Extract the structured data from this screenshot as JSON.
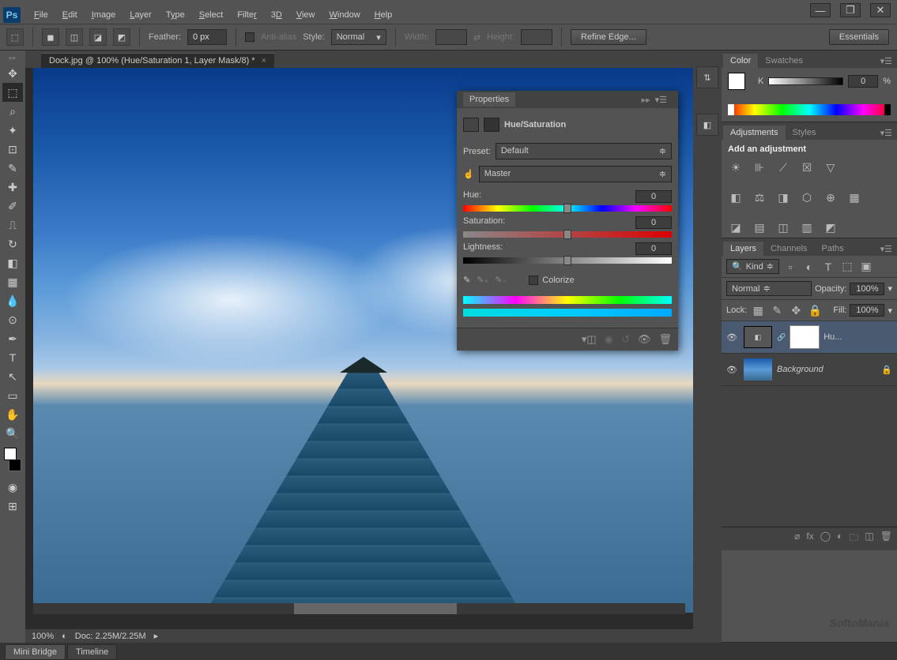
{
  "window": {
    "minimize": "—",
    "maximize": "❐",
    "close": "✕"
  },
  "menu": [
    "File",
    "Edit",
    "Image",
    "Layer",
    "Type",
    "Select",
    "Filter",
    "3D",
    "View",
    "Window",
    "Help"
  ],
  "options": {
    "feather_label": "Feather:",
    "feather_value": "0 px",
    "antialias": "Anti-alias",
    "style_label": "Style:",
    "style_value": "Normal",
    "width_label": "Width:",
    "height_label": "Height:",
    "refine": "Refine Edge...",
    "essentials": "Essentials"
  },
  "document": {
    "tab_title": "Dock.jpg @ 100% (Hue/Saturation 1, Layer Mask/8) *",
    "zoom": "100%",
    "doc_info": "Doc: 2.25M/2.25M"
  },
  "bottom_tabs": [
    "Mini Bridge",
    "Timeline"
  ],
  "color_panel": {
    "tabs": [
      "Color",
      "Swatches"
    ],
    "k_label": "K",
    "k_value": "0",
    "pct": "%"
  },
  "adjustments_panel": {
    "tabs": [
      "Adjustments",
      "Styles"
    ],
    "title": "Add an adjustment"
  },
  "layers_panel": {
    "tabs": [
      "Layers",
      "Channels",
      "Paths"
    ],
    "filter": "Kind",
    "blend_mode": "Normal",
    "opacity_label": "Opacity:",
    "opacity": "100%",
    "lock_label": "Lock:",
    "fill_label": "Fill:",
    "fill": "100%",
    "layers": [
      {
        "name": "Hu...",
        "locked": false
      },
      {
        "name": "Background",
        "locked": true
      }
    ]
  },
  "properties": {
    "title": "Properties",
    "type": "Hue/Saturation",
    "preset_label": "Preset:",
    "preset_value": "Default",
    "channel": "Master",
    "hue_label": "Hue:",
    "hue_value": "0",
    "sat_label": "Saturation:",
    "sat_value": "0",
    "light_label": "Lightness:",
    "light_value": "0",
    "colorize": "Colorize"
  },
  "watermark": "SoftoMania"
}
